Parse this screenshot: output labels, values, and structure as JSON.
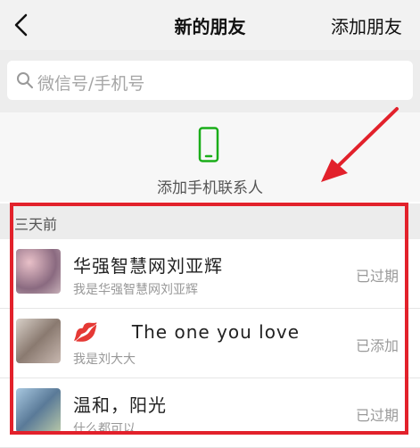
{
  "nav": {
    "title": "新的朋友",
    "add_friend": "添加朋友"
  },
  "search": {
    "placeholder": "微信号/手机号"
  },
  "add_contacts": {
    "label": "添加手机联系人"
  },
  "section": {
    "label": "三天前"
  },
  "friends": [
    {
      "name": "华强智慧网刘亚辉",
      "message": "我是华强智慧网刘亚辉",
      "status": "已过期",
      "avatar_color": "#c9a0a8"
    },
    {
      "name": "The one you love",
      "prefix": "💋",
      "message": "我是刘大大",
      "status": "已添加",
      "avatar_color": "#b8a8a0"
    },
    {
      "name": "温和，阳光",
      "message": "什么都可以",
      "status": "已过期",
      "avatar_color": "#7ea0b8"
    }
  ],
  "colors": {
    "accent_green": "#1aad19",
    "highlight_red": "#e2212b"
  },
  "icons": [
    "chevron-left-icon",
    "search-icon",
    "mobile-phone-icon"
  ]
}
